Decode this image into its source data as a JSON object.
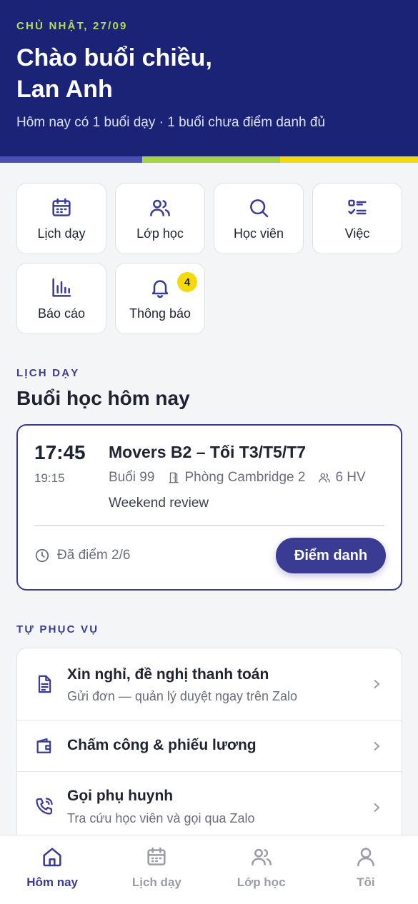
{
  "header": {
    "date": "CHỦ NHẬT, 27/09",
    "greeting": "Chào buổi chiều, Lan Anh",
    "summary": "Hôm nay có 1 buổi dạy · 1 buổi chưa điểm danh đủ"
  },
  "quick_actions": [
    {
      "label": "Lịch dạy",
      "icon": "calendar-icon"
    },
    {
      "label": "Lớp học",
      "icon": "users-icon"
    },
    {
      "label": "Học viên",
      "icon": "search-icon"
    },
    {
      "label": "Việc",
      "icon": "checklist-icon"
    },
    {
      "label": "Báo cáo",
      "icon": "bar-chart-icon"
    },
    {
      "label": "Thông báo",
      "icon": "bell-icon",
      "badge": "4"
    }
  ],
  "schedule": {
    "section_label": "LỊCH DẠY",
    "section_title": "Buổi học hôm nay",
    "session": {
      "start": "17:45",
      "end": "19:15",
      "title": "Movers B2 – Tối T3/T5/T7",
      "session_no": "Buổi 99",
      "room": "Phòng Cambridge 2",
      "students": "6 HV",
      "note": "Weekend review",
      "status": "Đã điểm 2/6",
      "action": "Điểm danh"
    }
  },
  "self_service": {
    "section_label": "TỰ PHỤC VỤ",
    "items": [
      {
        "title": "Xin nghỉ, đề nghị thanh toán",
        "subtitle": "Gửi đơn — quản lý duyệt ngay trên Zalo",
        "icon": "document-icon"
      },
      {
        "title": "Chấm công & phiếu lương",
        "subtitle": "",
        "icon": "wallet-icon"
      },
      {
        "title": "Gọi phụ huynh",
        "subtitle": "Tra cứu học viên và gọi qua Zalo",
        "icon": "phone-icon"
      }
    ]
  },
  "tabbar": [
    {
      "label": "Hôm nay",
      "icon": "home-icon",
      "active": true
    },
    {
      "label": "Lịch dạy",
      "icon": "calendar-icon"
    },
    {
      "label": "Lớp học",
      "icon": "users-icon"
    },
    {
      "label": "Tôi",
      "icon": "person-icon"
    }
  ],
  "colors": {
    "header_bg": "#1b2377",
    "accent": "#3a3c94",
    "date_green": "#b5dd52",
    "badge_yellow": "#f5d90a"
  }
}
